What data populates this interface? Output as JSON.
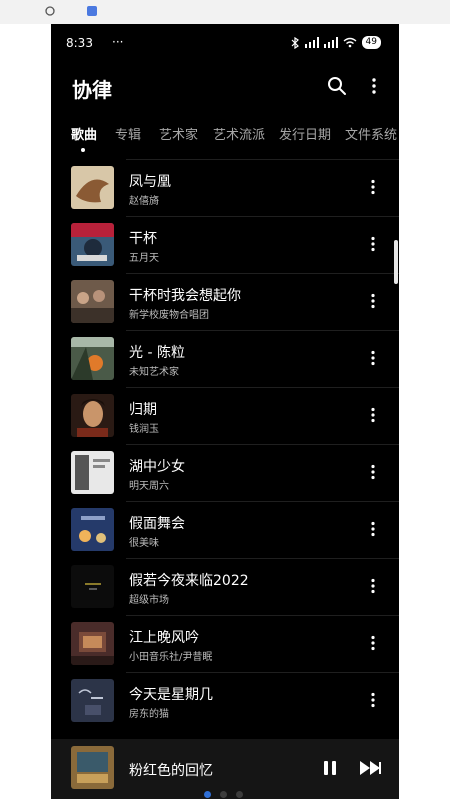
{
  "status_bar": {
    "time": "8:33",
    "dots": "···",
    "battery": "49"
  },
  "header": {
    "title": "协律"
  },
  "tabs": [
    {
      "label": "歌曲",
      "active": true
    },
    {
      "label": "专辑",
      "active": false
    },
    {
      "label": "艺术家",
      "active": false
    },
    {
      "label": "艺术流派",
      "active": false
    },
    {
      "label": "发行日期",
      "active": false
    },
    {
      "label": "文件系统",
      "active": false
    }
  ],
  "songs": [
    {
      "title": "凤与凰",
      "artist": "赵僖旖"
    },
    {
      "title": "干杯",
      "artist": "五月天"
    },
    {
      "title": "干杯时我会想起你",
      "artist": "新学校废物合唱团"
    },
    {
      "title": "光 - 陈粒",
      "artist": "未知艺术家"
    },
    {
      "title": "归期",
      "artist": "钱润玉"
    },
    {
      "title": "湖中少女",
      "artist": "明天周六"
    },
    {
      "title": "假面舞会",
      "artist": "很美味"
    },
    {
      "title": "假若今夜来临2022",
      "artist": "超级市场"
    },
    {
      "title": "江上晚风吟",
      "artist": "小田音乐社/尹昔眠"
    },
    {
      "title": "今天是星期几",
      "artist": "房东的猫"
    }
  ],
  "now_playing": {
    "title": "粉红色的回忆"
  },
  "colors": {
    "background": "#000000",
    "accent": "#2f6fd6",
    "text": "#ffffff",
    "subtext": "#bdbdbd"
  }
}
